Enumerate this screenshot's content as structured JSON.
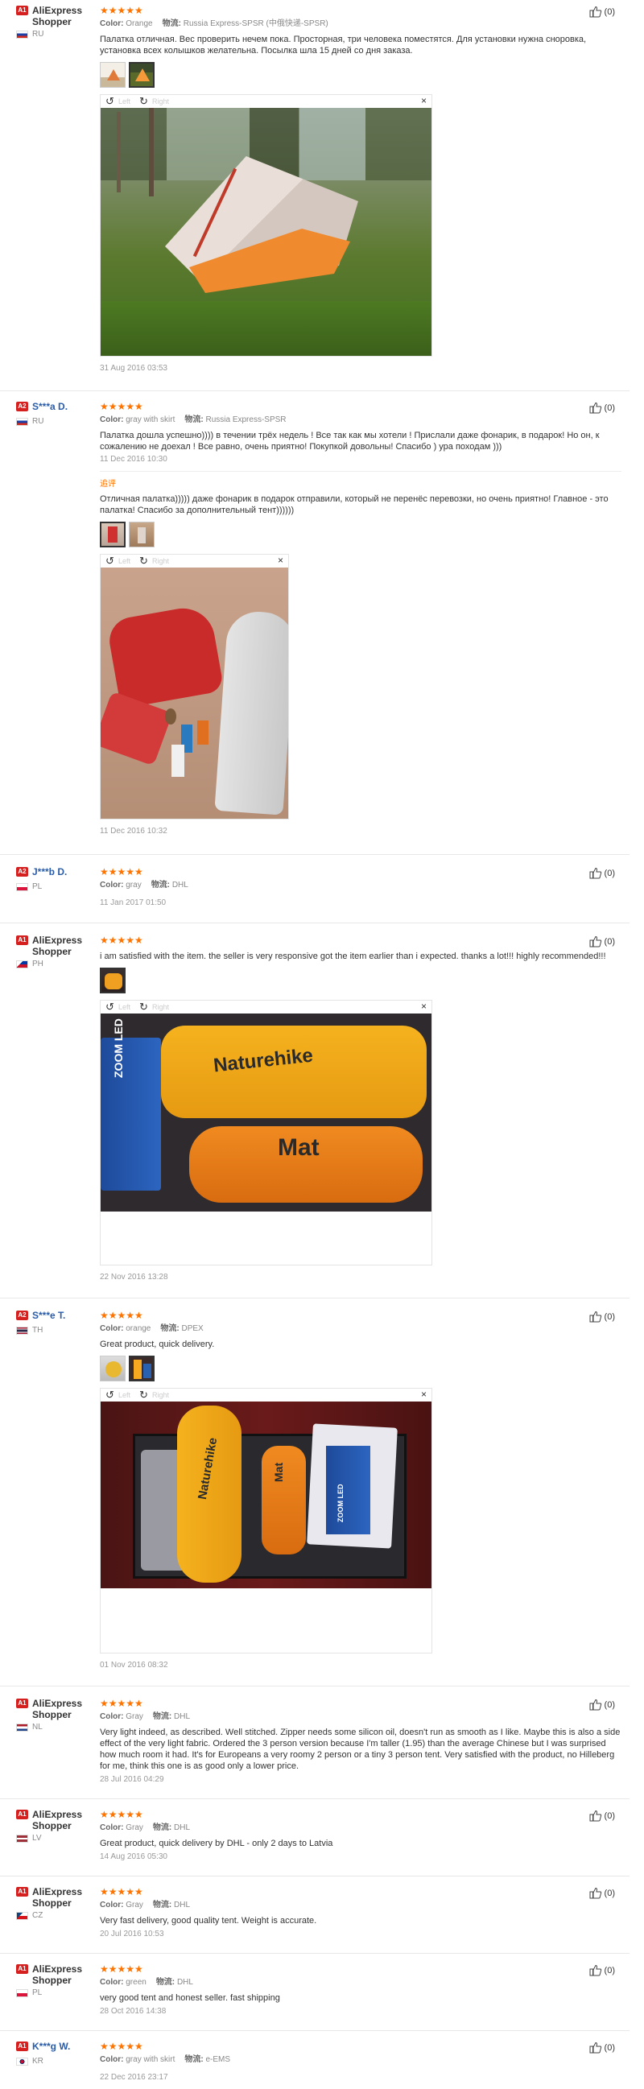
{
  "reviews": [
    {
      "badge": "A1",
      "name": "AliExpress Shopper",
      "country": "RU",
      "stars": "★★★★★",
      "color_label": "Color:",
      "color": "Orange",
      "ship_label": "物流:",
      "ship": "Russia Express-SPSR (中俄快递-SPSR)",
      "text": "Палатка отличная. Вес проверить нечем пока. Просторная, три человека поместятся. Для установки нужна сноровка, установка всех колышков желательна. Посылка шла 15 дней со дня заказа.",
      "date": "31 Aug 2016 03:53",
      "helpful": "(0)"
    },
    {
      "badge": "A2",
      "name": "S***a D.",
      "country": "RU",
      "stars": "★★★★★",
      "color_label": "Color:",
      "color": "gray with skirt",
      "ship_label": "物流:",
      "ship": "Russia Express-SPSR",
      "text": "Палатка дошла успешно)))) в течении трёх недель ! Все так как мы хотели ! Прислали даже фонарик, в подарок! Но он, к сожалению не доехал ! Все равно, очень приятно! Покупкой довольны! Спасибо ) ура походам )))",
      "date": "11 Dec 2016 10:30",
      "add_label": "追评",
      "add_text": "Отличная палатка))))) даже фонарик в подарок отправили, который не перенёс перевозки, но очень приятно! Главное - это палатка! Спасибо за дополнительный тент))))))",
      "add_date": "11 Dec 2016 10:32",
      "helpful": "(0)"
    },
    {
      "badge": "A2",
      "name": "J***b D.",
      "country": "PL",
      "stars": "★★★★★",
      "color_label": "Color:",
      "color": "gray",
      "ship_label": "物流:",
      "ship": "DHL",
      "date": "11 Jan 2017 01:50",
      "helpful": "(0)"
    },
    {
      "badge": "A1",
      "name": "AliExpress Shopper",
      "country": "PH",
      "stars": "★★★★★",
      "text": "i am satisfied with the item. the seller is very responsive got the item earlier than i expected. thanks a lot!!! highly recommended!!!",
      "date": "22 Nov 2016 13:28",
      "helpful": "(0)",
      "photo_text1": "Naturehike",
      "photo_text2": "Mat",
      "photo_text3": "ZOOM LED"
    },
    {
      "badge": "A2",
      "name": "S***e T.",
      "country": "TH",
      "stars": "★★★★★",
      "color_label": "Color:",
      "color": "orange",
      "ship_label": "物流:",
      "ship": "DPEX",
      "text": "Great product, quick delivery.",
      "date": "01 Nov 2016 08:32",
      "helpful": "(0)",
      "photo_text1": "Naturehike",
      "photo_text2": "Mat",
      "photo_text3": "ZOOM LED"
    },
    {
      "badge": "A1",
      "name": "AliExpress Shopper",
      "country": "NL",
      "stars": "★★★★★",
      "color_label": "Color:",
      "color": "Gray",
      "ship_label": "物流:",
      "ship": "DHL",
      "text": "Very light indeed, as described. Well stitched. Zipper needs some silicon oil, doesn't run as smooth as I like. Maybe this is also a side effect of the very light fabric. Ordered the 3 person version because I'm taller (1.95) than the average Chinese but I was surprised how much room it had. It's for Europeans a very roomy 2 person or a tiny 3 person tent. Very satisfied with the product, no Hilleberg for me, think this one is as good only a lower price.",
      "date": "28 Jul 2016 04:29",
      "helpful": "(0)"
    },
    {
      "badge": "A1",
      "name": "AliExpress Shopper",
      "country": "LV",
      "stars": "★★★★★",
      "color_label": "Color:",
      "color": "Gray",
      "ship_label": "物流:",
      "ship": "DHL",
      "text": "Great product, quick delivery by DHL - only 2 days to Latvia",
      "date": "14 Aug 2016 05:30",
      "helpful": "(0)"
    },
    {
      "badge": "A1",
      "name": "AliExpress Shopper",
      "country": "CZ",
      "stars": "★★★★★",
      "color_label": "Color:",
      "color": "Gray",
      "ship_label": "物流:",
      "ship": "DHL",
      "text": "Very fast delivery, good quality tent. Weight is accurate.",
      "date": "20 Jul 2016 10:53",
      "helpful": "(0)"
    },
    {
      "badge": "A1",
      "name": "AliExpress Shopper",
      "country": "PL",
      "stars": "★★★★★",
      "color_label": "Color:",
      "color": "green",
      "ship_label": "物流:",
      "ship": "DHL",
      "text": "very good tent and honest seller. fast shipping",
      "date": "28 Oct 2016 14:38",
      "helpful": "(0)"
    },
    {
      "badge": "A1",
      "name": "K***g W.",
      "country": "KR",
      "stars": "★★★★★",
      "color_label": "Color:",
      "color": "gray with skirt",
      "ship_label": "物流:",
      "ship": "e-EMS",
      "date": "22 Dec 2016 23:17",
      "helpful": "(0)"
    }
  ],
  "viewer": {
    "left_label": "Left",
    "right_label": "Right",
    "close": "×"
  },
  "icons": {
    "helpful": "thumbs-up-icon",
    "rotate_left": "rotate-left-icon",
    "rotate_right": "rotate-right-icon",
    "close": "close-icon"
  },
  "colors": {
    "stars": "#ff7300",
    "badge": "#d52020",
    "masked_name": "#2a5ca8"
  }
}
